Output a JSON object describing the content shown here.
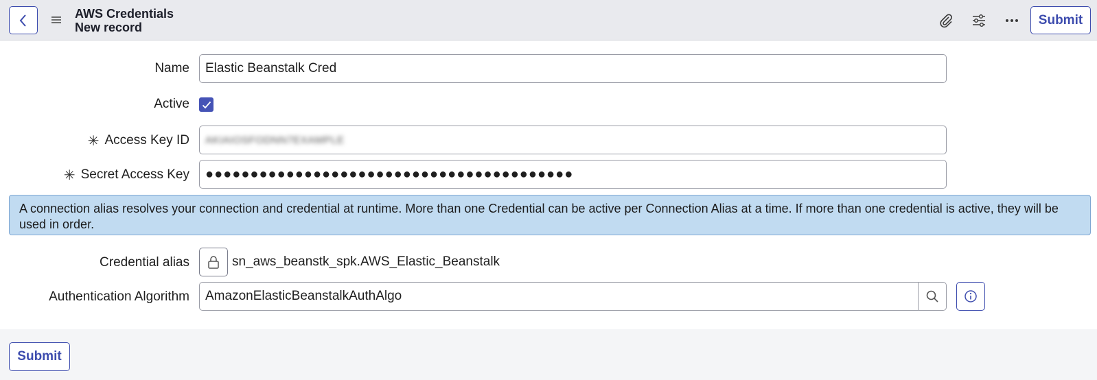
{
  "header": {
    "title": "AWS Credentials",
    "subtitle": "New record",
    "submit_label": "Submit",
    "icons": [
      "back-icon",
      "menu-icon",
      "paperclip-icon",
      "sliders-icon",
      "more-icon"
    ]
  },
  "form": {
    "name": {
      "label": "Name",
      "value": "Elastic Beanstalk Cred"
    },
    "active": {
      "label": "Active",
      "checked": true
    },
    "access_key": {
      "label": "Access Key ID",
      "required_mark": "✳",
      "value": "AKIAIOSFODNN7EXAMPLE"
    },
    "secret_key": {
      "label": "Secret Access Key",
      "required_mark": "✳",
      "value": "●●●●●●●●●●●●●●●●●●●●●●●●●●●●●●●●●●●●●●●●●"
    },
    "info_message": "A connection alias resolves your connection and credential at runtime. More than one Credential can be active per Connection Alias at a time. If more than one credential is active, they will be used in order.",
    "credential_alias": {
      "label": "Credential alias",
      "value": "sn_aws_beanstk_spk.AWS_Elastic_Beanstalk"
    },
    "auth_algorithm": {
      "label": "Authentication Algorithm",
      "value": "AmazonElasticBeanstalkAuthAlgo"
    }
  },
  "footer": {
    "submit_label": "Submit"
  },
  "colors": {
    "accent": "#3d4cae",
    "info_bg": "#c1dbf1",
    "header_bg": "#e9eaee"
  }
}
